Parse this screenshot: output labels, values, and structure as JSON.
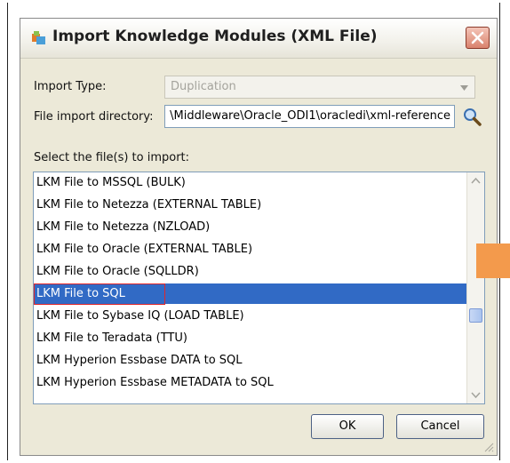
{
  "dialog": {
    "title": "Import Knowledge Modules (XML File)",
    "import_type_label": "Import Type:",
    "import_type_value": "Duplication",
    "file_dir_label": "File import directory:",
    "file_dir_value": "\\Middleware\\Oracle_ODI1\\oracledi\\xml-reference",
    "select_label": "Select the file(s) to import:",
    "files": [
      "LKM File to MSSQL (BULK)",
      "LKM File to Netezza (EXTERNAL TABLE)",
      "LKM File to Netezza (NZLOAD)",
      "LKM File to Oracle (EXTERNAL TABLE)",
      "LKM File to Oracle (SQLLDR)",
      "LKM File to SQL",
      "LKM File to Sybase IQ (LOAD TABLE)",
      "LKM File to Teradata (TTU)",
      "LKM Hyperion Essbase DATA to SQL",
      "LKM Hyperion Essbase METADATA to SQL"
    ],
    "selected_file": "LKM File to SQL",
    "ok_label": "OK",
    "cancel_label": "Cancel"
  },
  "colors": {
    "selection": "#316ac5",
    "highlight_outline": "#e0262b",
    "side_marker": "#f39a4c"
  }
}
